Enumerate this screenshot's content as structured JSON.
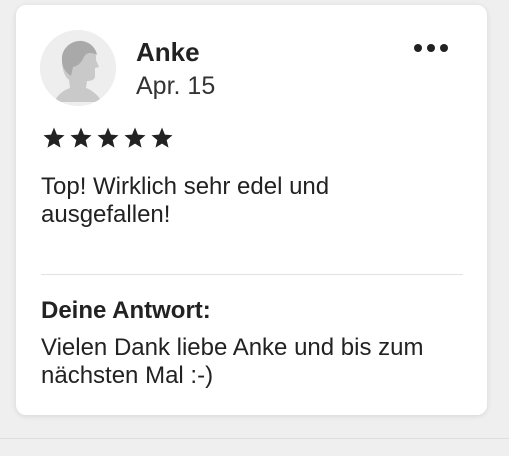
{
  "review": {
    "author_name": "Anke",
    "date": "Apr. 15",
    "rating": 5,
    "rating_max": 5,
    "text": "Top! Wirklich sehr edel und ausgefallen!",
    "avatar_icon": "default-person-avatar-icon",
    "more_icon": "more-horizontal-icon"
  },
  "reply": {
    "heading": "Deine Antwort:",
    "text": "Vielen Dank liebe Anke und bis zum nächsten Mal :-)"
  },
  "colors": {
    "star": "#222222",
    "text": "#222222",
    "background": "#efefef",
    "card": "#ffffff"
  }
}
